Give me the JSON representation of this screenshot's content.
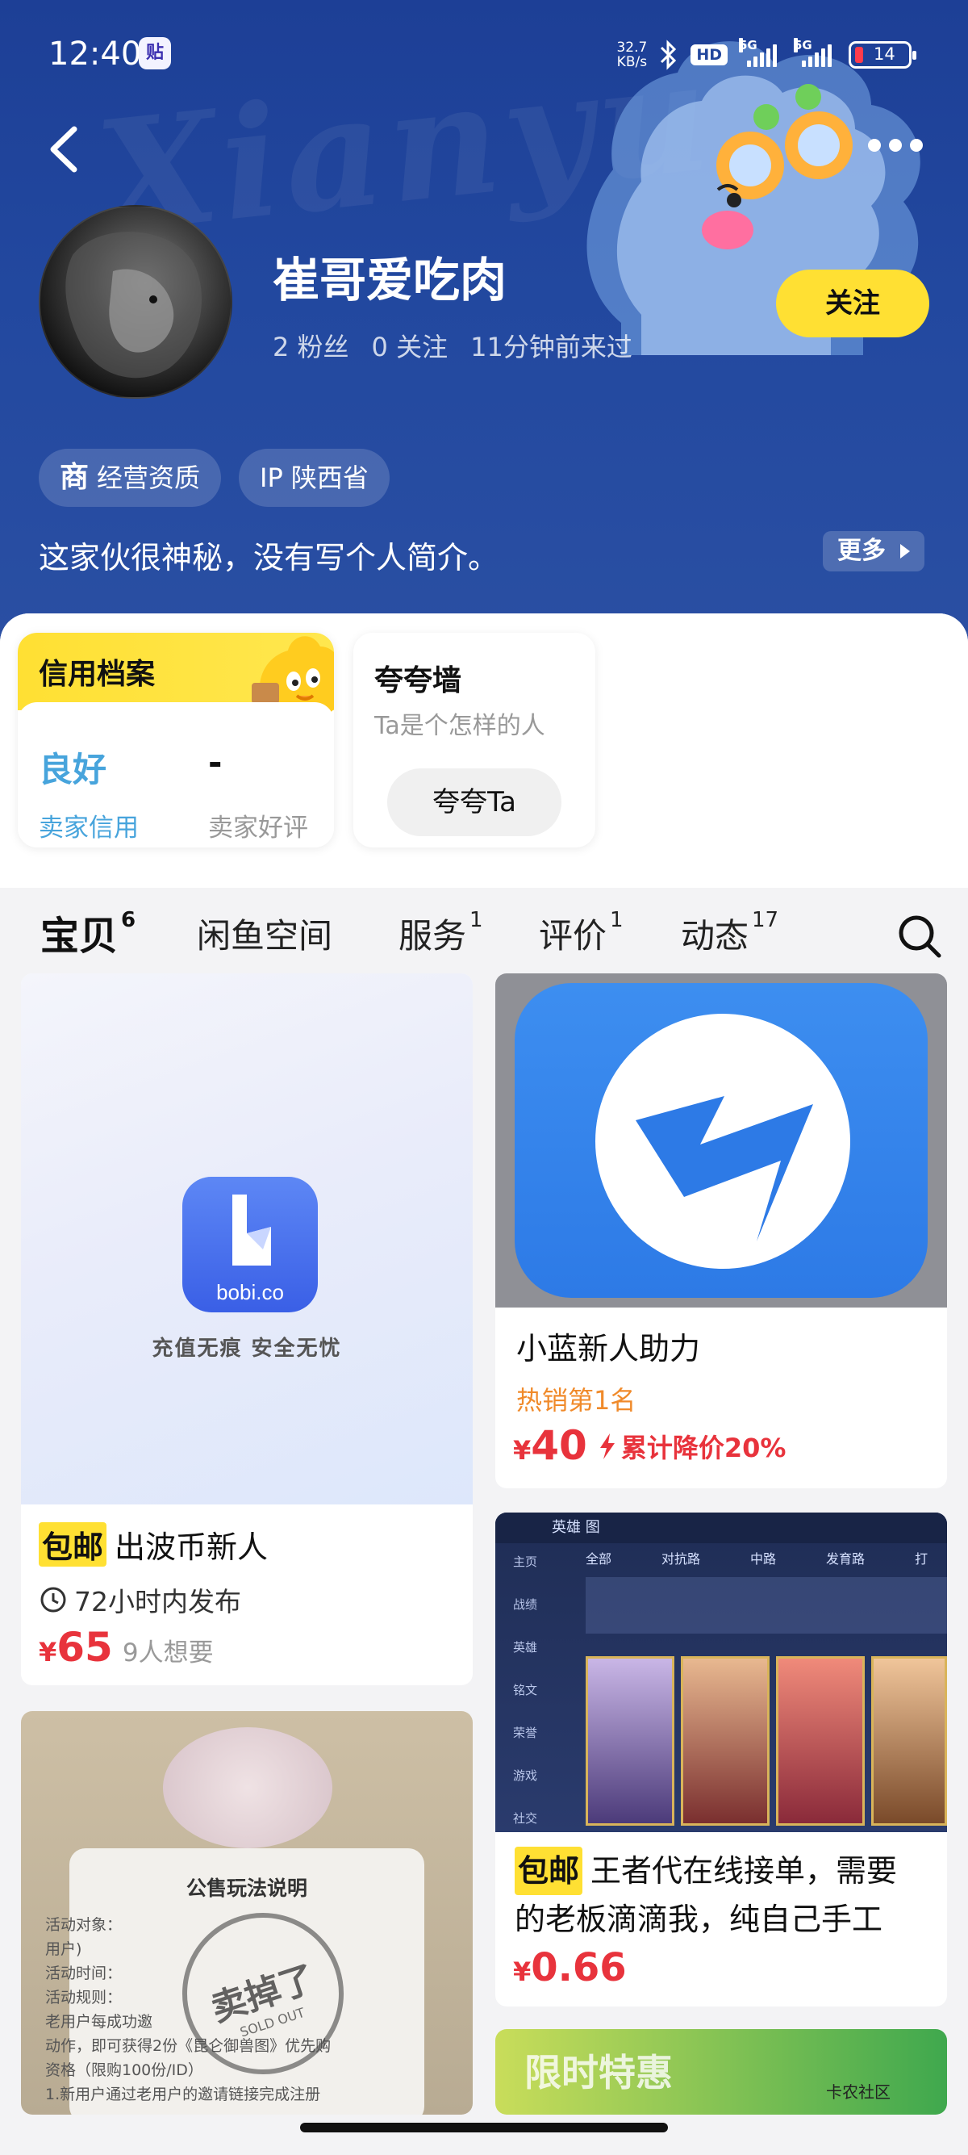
{
  "status_bar": {
    "time": "12:40",
    "app_icon": "贴",
    "net_speed_value": "32.7",
    "net_speed_unit": "KB/s",
    "hd": "HD",
    "sim1": "5G",
    "sim2": "5G",
    "battery": "14"
  },
  "profile": {
    "name": "崔哥爱吃肉",
    "fans": "2 粉丝",
    "following": "0 关注",
    "last_seen": "11分钟前来过",
    "follow_label": "关注",
    "tag_business_icon": "商",
    "tag_business": "经营资质",
    "tag_ip": "IP 陕西省",
    "bio": "这家伙很神秘，没有写个人简介。",
    "more_label": "更多",
    "watermark": "Xianyu"
  },
  "credit": {
    "title": "信用档案",
    "seller_credit_value": "良好",
    "seller_credit_label": "卖家信用",
    "seller_review_value": "-",
    "seller_review_label": "卖家好评"
  },
  "praise": {
    "title": "夸夸墙",
    "subtitle": "Ta是个怎样的人",
    "button": "夸夸Ta"
  },
  "tabs": [
    {
      "label": "宝贝",
      "count": "6"
    },
    {
      "label": "闲鱼空间",
      "count": ""
    },
    {
      "label": "服务",
      "count": "1"
    },
    {
      "label": "评价",
      "count": "1"
    },
    {
      "label": "动态",
      "count": "17"
    }
  ],
  "products": {
    "p1": {
      "image_brand": "bobi.co",
      "image_slogan": "充值无痕 安全无忧",
      "badge": "包邮",
      "title": "出波币新人",
      "published": "72小时内发布",
      "currency": "¥",
      "price": "65",
      "wants": "9人想要"
    },
    "p2": {
      "title": "小蓝新人助力",
      "rank": "热销第1名",
      "currency": "¥",
      "price": "40",
      "discount": "累计降价20%"
    },
    "p3": {
      "image_tabs": [
        "全部",
        "对抗路",
        "中路",
        "发育路",
        "打"
      ],
      "image_side": [
        "主页",
        "战绩",
        "英雄",
        "铭文",
        "荣誉",
        "游戏",
        "社交"
      ],
      "image_header": "英雄 图",
      "badge": "包邮",
      "title_line1": "王者代在线接单，需要",
      "title_line2": "的老板滴滴我，纯自己手工",
      "currency": "¥",
      "price": "0.66"
    },
    "p4": {
      "notice_title": "公售玩法说明",
      "notice_lines": [
        "活动对象：",
        "用户)",
        "活动时间：",
        "活动规则：",
        "老用户每成功邀",
        "动作，即可获得2份《昆仑御兽图》优先购",
        "资格（限购100份/ID）",
        "1.新用户通过老用户的邀请链接完成注册"
      ],
      "stamp": "卖掉了",
      "stamp_sub": "SOLD OUT"
    },
    "p5": {
      "banner": "限时特惠",
      "watermark": "卡农社区"
    }
  },
  "colors": {
    "hero_blue": "#22489f",
    "accent_yellow": "#ffe033",
    "price_red": "#e8333c",
    "credit_blue": "#47a4dc",
    "rank_orange": "#f08a2a"
  }
}
